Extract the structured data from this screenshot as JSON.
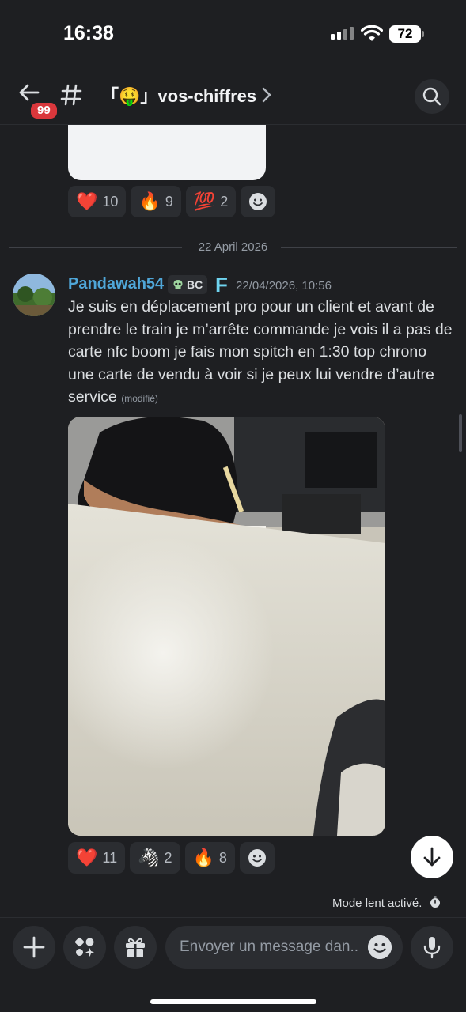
{
  "status_bar": {
    "time": "16:38",
    "battery": "72"
  },
  "header": {
    "unread_count": "99",
    "channel_name": "「🤑」vos-chiffres",
    "back_icon": "arrow-left-icon",
    "search_icon": "search-icon"
  },
  "previous_reactions": [
    {
      "emoji": "❤️",
      "count": "10"
    },
    {
      "emoji": "🔥",
      "count": "9"
    },
    {
      "emoji": "💯",
      "count": "2"
    }
  ],
  "date_divider": "22 April 2026",
  "message": {
    "author": "Pandawah54",
    "tag": "BC",
    "role_icon_letter": "F",
    "timestamp": "22/04/2026, 10:56",
    "text": "Je suis en déplacement pro pour un client et avant de prendre le train je m’arrête commande je vois il a pas de carte nfc boom je fais mon spitch en 1:30 top chrono une carte de vendu à voir si je peux lui vendre d’autre service",
    "edited_label": "(modifié)",
    "reactions": [
      {
        "emoji": "❤️",
        "count": "11"
      },
      {
        "emoji": "🦓",
        "count": "2"
      },
      {
        "emoji": "🔥",
        "count": "8"
      }
    ]
  },
  "slowmode_text": "Mode lent activé.",
  "composer": {
    "placeholder": "Envoyer un message dan.."
  },
  "colors": {
    "background": "#1e1f22",
    "username": "#4fa6d8",
    "badge": "#da373c"
  }
}
